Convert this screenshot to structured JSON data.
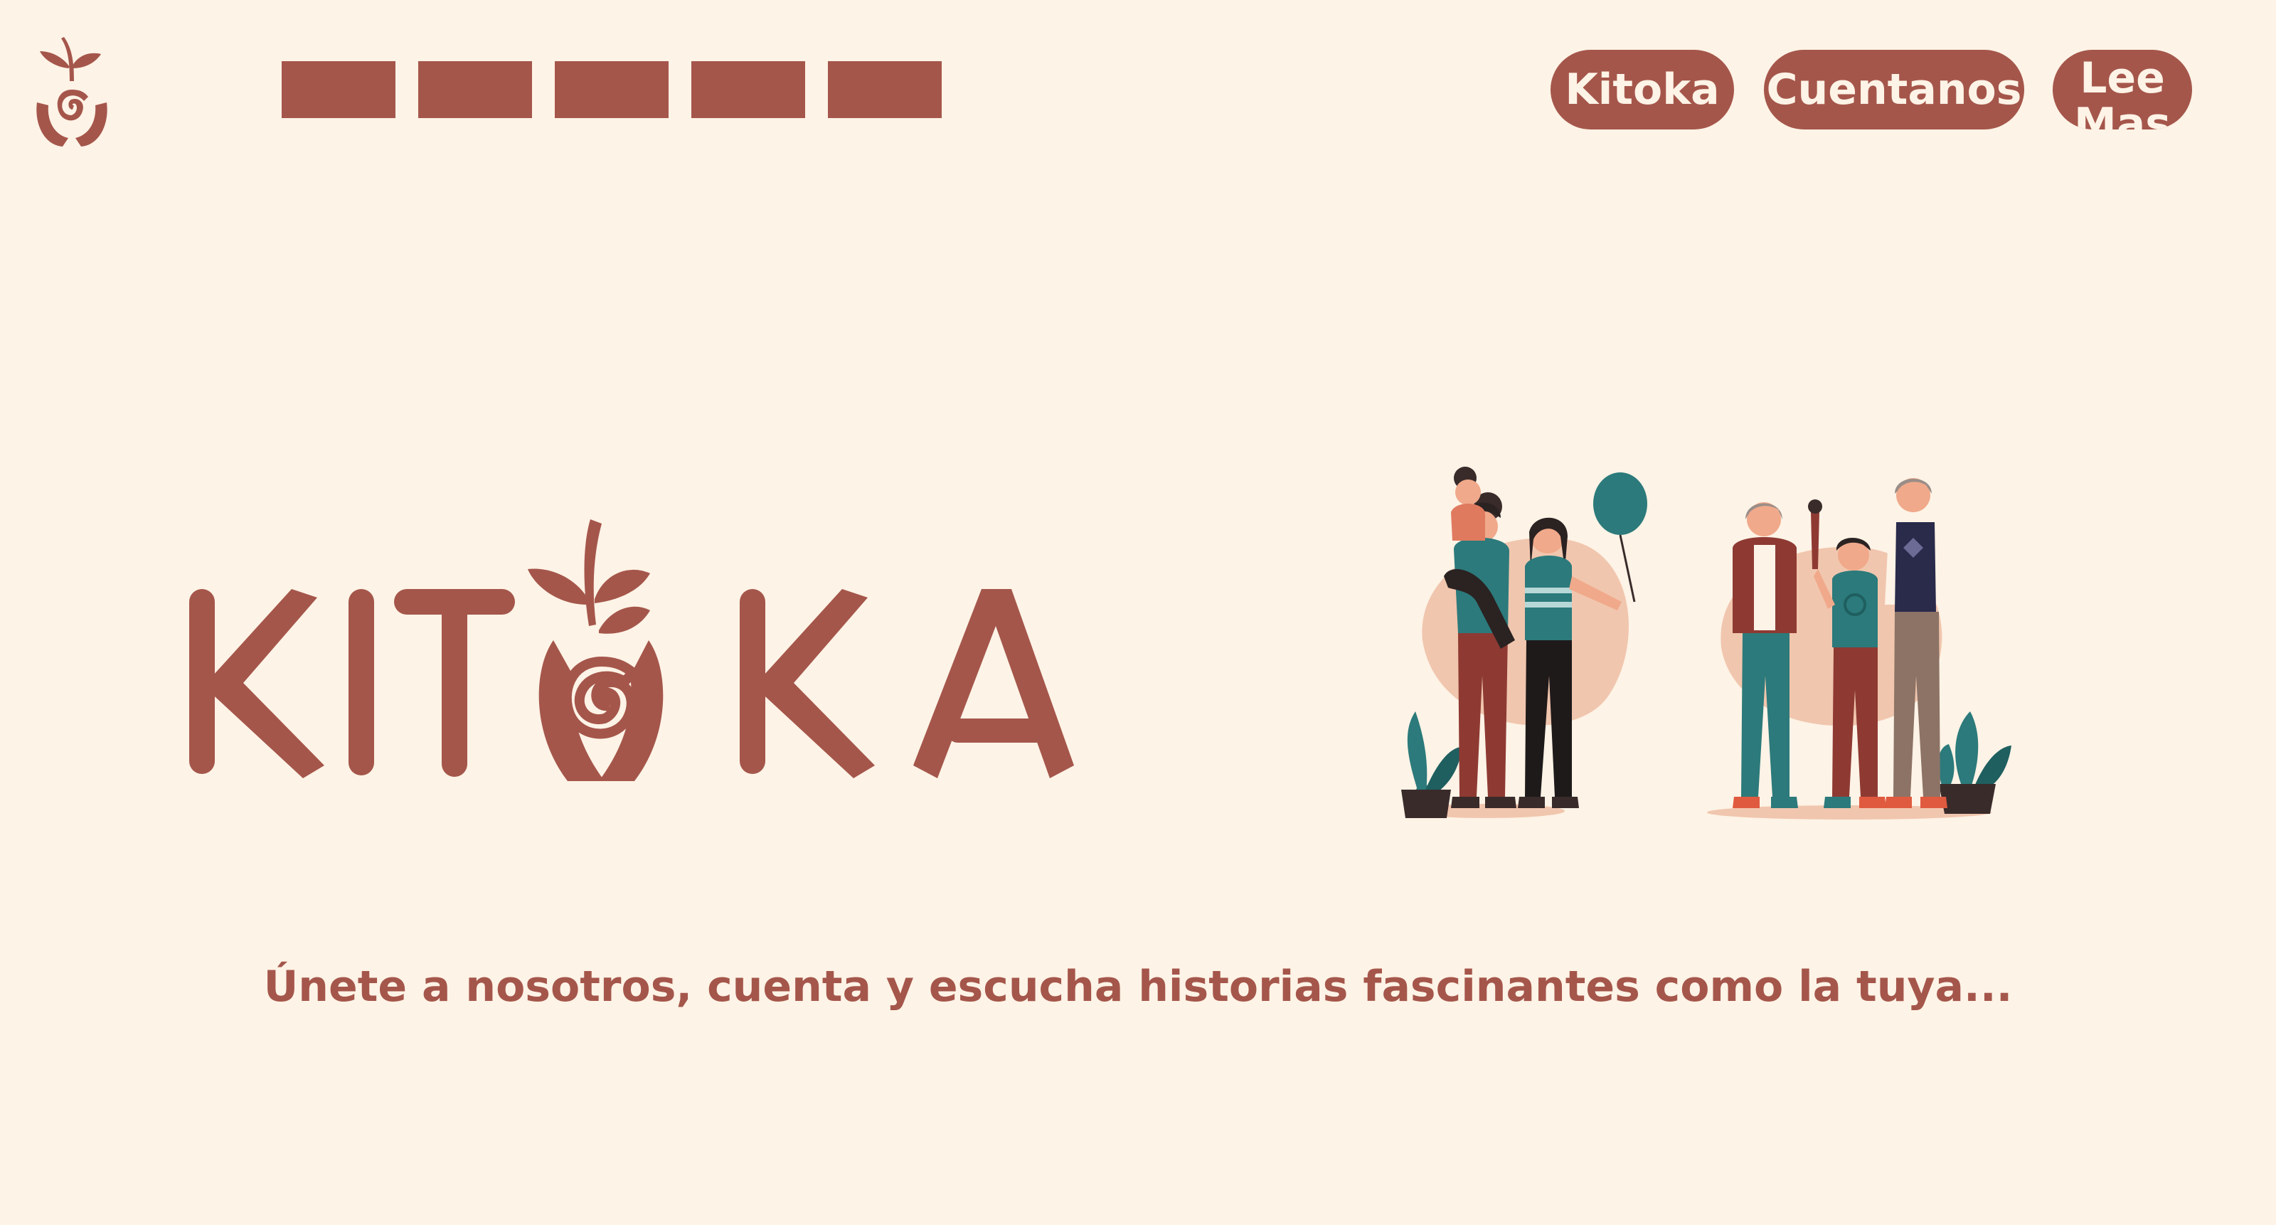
{
  "header": {
    "logo_icon": "seed-hands-logo-icon",
    "nav_pills": [
      {
        "label": "Kitoka"
      },
      {
        "label": "Cuentanos"
      },
      {
        "label": "Lee Mas"
      }
    ]
  },
  "hero": {
    "wordmark_text": "KITOKA",
    "illustration": "family-group-illustration",
    "tagline": "Únete a nosotros, cuenta y escucha historias fascinantes como la tuya..."
  },
  "colors": {
    "background": "#fdf3e6",
    "brand": "#a5564b",
    "teal": "#2c7a7b",
    "peach": "#f1c6ae"
  }
}
